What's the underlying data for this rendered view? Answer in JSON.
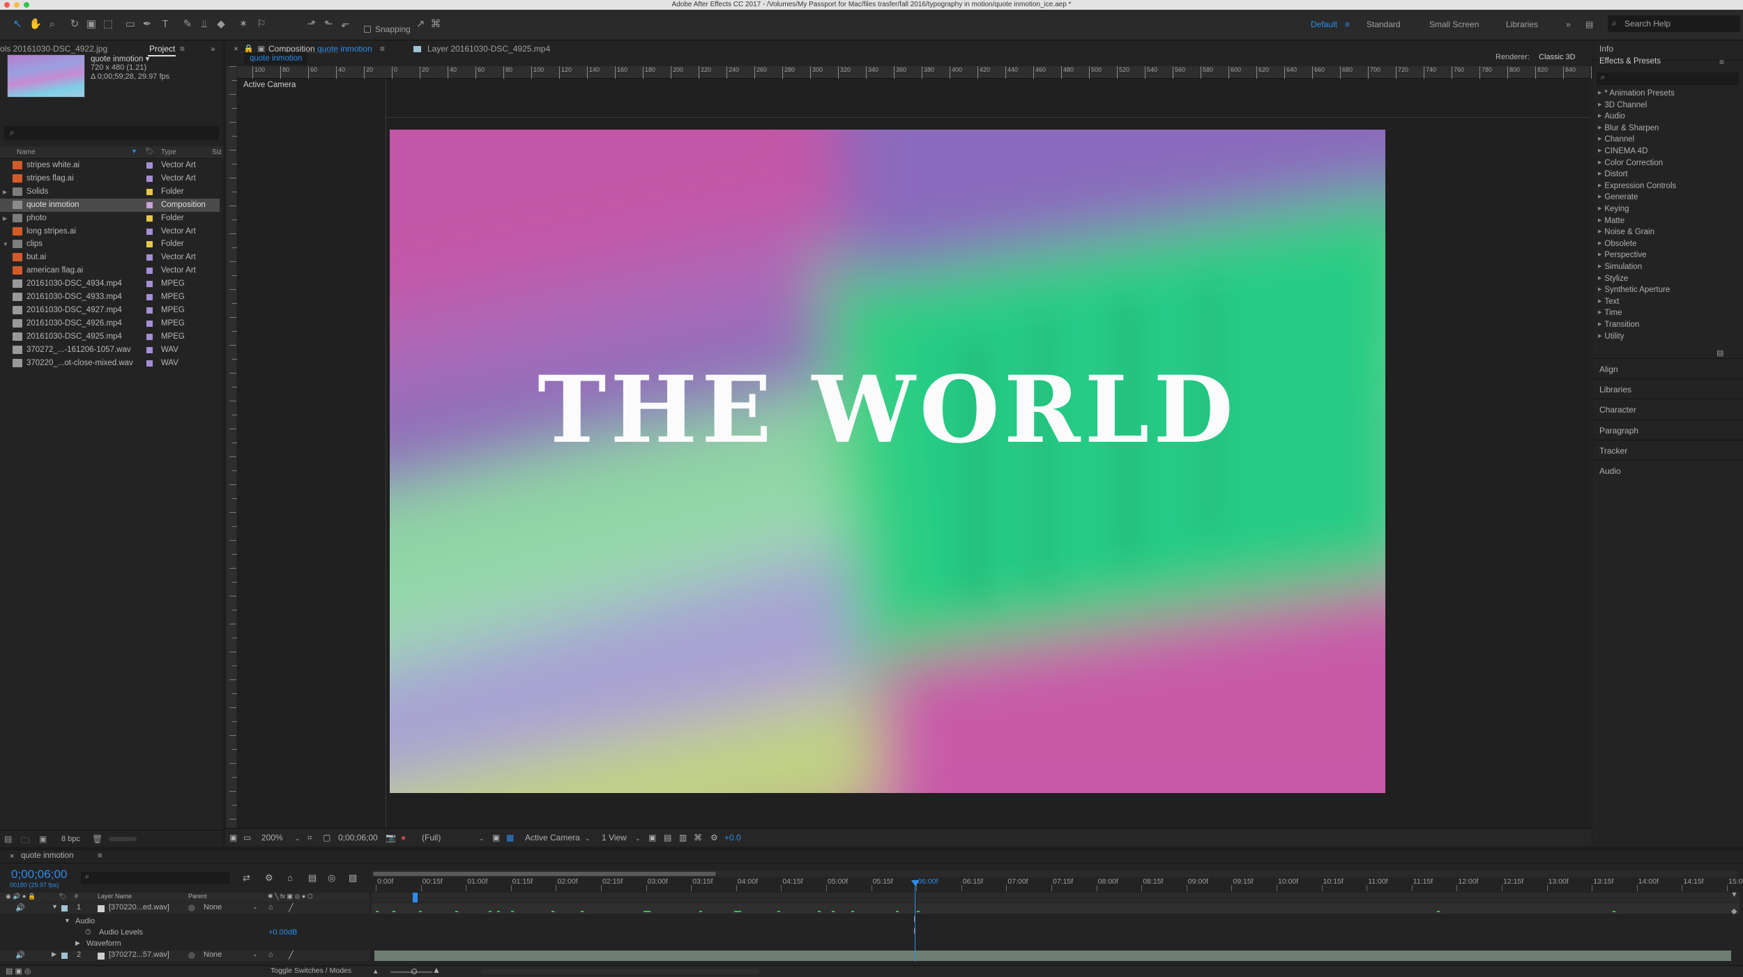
{
  "titlebar": {
    "title": "Adobe After Effects CC 2017 - /Volumes/My Passport for Mac/files trasfer/fall 2016/typography in motion/quote inmotion_ice.aep *"
  },
  "toolbar": {
    "snapping_label": "Snapping"
  },
  "workspaces": {
    "default": "Default",
    "standard": "Standard",
    "small_screen": "Small Screen",
    "libraries": "Libraries",
    "search_help": "Search Help"
  },
  "project_panel": {
    "footage_tab": "ols 20161030-DSC_4922.jpg",
    "project_tab": "Project",
    "preview": {
      "name": "quote inmotion ▾",
      "dims": "720 x 480 (1.21)",
      "duration": "Δ 0;00;59;28, 29.97 fps"
    },
    "columns": {
      "name": "Name",
      "type": "Type",
      "size": "Siz"
    },
    "bpc": "8 bpc",
    "items": [
      {
        "name": "stripes white.ai",
        "type": "Vector Art",
        "color": "#a58fd4",
        "icon": "ai-file-icon"
      },
      {
        "name": "stripes flag.ai",
        "type": "Vector Art",
        "color": "#a58fd4",
        "icon": "ai-file-icon"
      },
      {
        "name": "Solids",
        "type": "Folder",
        "color": "#e6c64a",
        "icon": "folder-icon",
        "twirl": "▶"
      },
      {
        "name": "quote inmotion",
        "type": "Composition",
        "color": "#c9a2d6",
        "icon": "composition-icon"
      },
      {
        "name": "photo",
        "type": "Folder",
        "color": "#e6c64a",
        "icon": "folder-icon",
        "twirl": "▶"
      },
      {
        "name": "long stripes.ai",
        "type": "Vector Art",
        "color": "#a58fd4",
        "icon": "ai-file-icon"
      },
      {
        "name": "clips",
        "type": "Folder",
        "color": "#e6c64a",
        "icon": "folder-icon",
        "twirl": "▼"
      },
      {
        "name": "but.ai",
        "type": "Vector Art",
        "color": "#a58fd4",
        "icon": "ai-file-icon"
      },
      {
        "name": "american flag.ai",
        "type": "Vector Art",
        "color": "#a58fd4",
        "icon": "ai-file-icon"
      },
      {
        "name": "20161030-DSC_4934.mp4",
        "type": "MPEG",
        "color": "#a58fd4",
        "icon": "video-file-icon"
      },
      {
        "name": "20161030-DSC_4933.mp4",
        "type": "MPEG",
        "color": "#a58fd4",
        "icon": "video-file-icon"
      },
      {
        "name": "20161030-DSC_4927.mp4",
        "type": "MPEG",
        "color": "#a58fd4",
        "icon": "video-file-icon"
      },
      {
        "name": "20161030-DSC_4926.mp4",
        "type": "MPEG",
        "color": "#a58fd4",
        "icon": "video-file-icon"
      },
      {
        "name": "20161030-DSC_4925.mp4",
        "type": "MPEG",
        "color": "#a58fd4",
        "icon": "video-file-icon"
      },
      {
        "name": "370272_...-161206-1057.wav",
        "type": "WAV",
        "color": "#a58fd4",
        "icon": "audio-file-icon"
      },
      {
        "name": "370220_...ot-close-mixed.wav",
        "type": "WAV",
        "color": "#a58fd4",
        "icon": "audio-file-icon"
      }
    ]
  },
  "viewer": {
    "comp_tab_prefix": "Composition",
    "comp_tab_name": "quote inmotion",
    "layer_tab": "Layer 20161030-DSC_4925.mp4",
    "subtab": "quote inmotion",
    "renderer_label": "Renderer:",
    "renderer_value": "Classic 3D",
    "camera_label": "Active Camera",
    "comp_text": "THE WORLD",
    "ruler_labels": [
      "100",
      "80",
      "60",
      "40",
      "20",
      "0",
      "20",
      "40",
      "60",
      "80",
      "100",
      "120",
      "140",
      "160",
      "180",
      "200",
      "220",
      "240",
      "260",
      "280",
      "300",
      "320",
      "340",
      "360",
      "380",
      "400",
      "420",
      "440",
      "460",
      "480",
      "500",
      "520",
      "540",
      "560",
      "580",
      "600",
      "620",
      "640",
      "660",
      "680",
      "700",
      "720",
      "740",
      "760",
      "780",
      "800",
      "820",
      "840",
      "860"
    ],
    "bottom": {
      "zoom": "200%",
      "timecode": "0;00;06;00",
      "resolution": "(Full)",
      "camera": "Active Camera",
      "views": "1 View",
      "exposure": "+0.0"
    }
  },
  "info_panel": {
    "title": "Info"
  },
  "effects_panel": {
    "title": "Effects & Presets",
    "items": [
      "* Animation Presets",
      "3D Channel",
      "Audio",
      "Blur & Sharpen",
      "Channel",
      "CINEMA 4D",
      "Color Correction",
      "Distort",
      "Expression Controls",
      "Generate",
      "Keying",
      "Matte",
      "Noise & Grain",
      "Obsolete",
      "Perspective",
      "Simulation",
      "Stylize",
      "Synthetic Aperture",
      "Text",
      "Time",
      "Transition",
      "Utility"
    ]
  },
  "side_panels": [
    "Align",
    "Libraries",
    "Character",
    "Paragraph",
    "Tracker",
    "Audio"
  ],
  "timeline": {
    "comp_tab": "quote inmotion",
    "timecode": "0;00;06;00",
    "frame_info": "00180 (29.97 fps)",
    "columns": {
      "num": "#",
      "layer_name": "Layer Name",
      "parent": "Parent"
    },
    "layers": [
      {
        "num": "1",
        "name": "[370220...ed.wav]",
        "parent": "None",
        "twirl": "▼"
      },
      {
        "num": "2",
        "name": "[370272...57.wav]",
        "parent": "None",
        "twirl": "▶"
      }
    ],
    "audio_group": "Audio",
    "audio_levels_label": "Audio Levels",
    "audio_levels_value": "+0.00dB",
    "waveform_label": "Waveform",
    "toggle_label": "Toggle Switches / Modes",
    "time_ticks": [
      "0:00f",
      "00:15f",
      "01:00f",
      "01:15f",
      "02:00f",
      "02:15f",
      "03:00f",
      "03:15f",
      "04:00f",
      "04:15f",
      "05:00f",
      "05:15f",
      "06:00f",
      "06:15f",
      "07:00f",
      "07:15f",
      "08:00f",
      "08:15f",
      "09:00f",
      "09:15f",
      "10:00f",
      "10:15f",
      "11:00f",
      "11:15f",
      "12:00f",
      "12:15f",
      "13:00f",
      "13:15f",
      "14:00f",
      "14:15f",
      "15:0"
    ],
    "playhead_index": 12
  },
  "colors": {
    "accent": "#2d8ceb",
    "background": "#1d1d1d",
    "panel": "#232323",
    "selection": "#4b4b4b",
    "keyframe": "#37c34e"
  }
}
